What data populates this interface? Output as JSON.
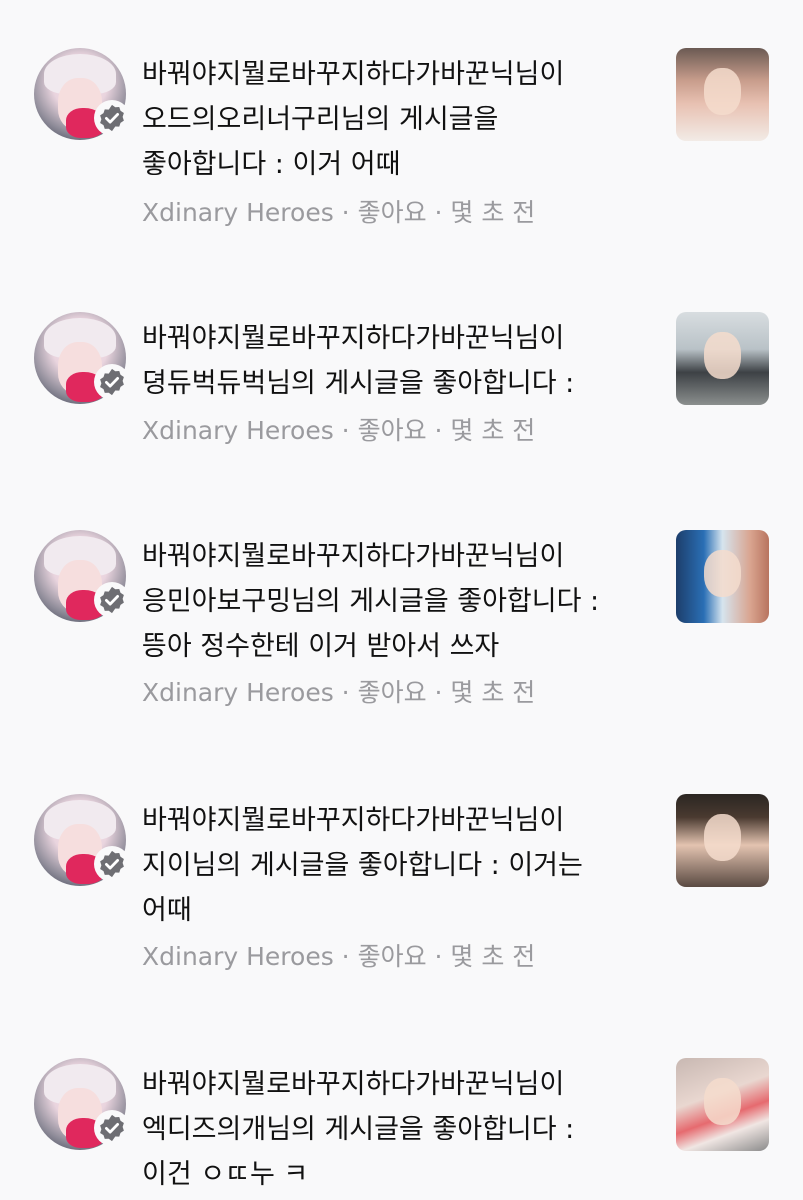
{
  "notifications": [
    {
      "lines": [
        "바꿔야지뭘로바꾸지하다가바꾼닉님이",
        "오드의오리너구리님의 게시글을",
        "좋아합니다 : 이거 어때"
      ],
      "meta": "Xdinary Heroes · 좋아요 · 몇 초 전"
    },
    {
      "lines": [
        "바꿔야지뭘로바꾸지하다가바꾼닉님이",
        "뎡듀벅듀벅님의 게시글을 좋아합니다 :"
      ],
      "meta": "Xdinary Heroes · 좋아요 · 몇 초 전"
    },
    {
      "lines": [
        "바꿔야지뭘로바꾸지하다가바꾼닉님이",
        "응민아보구밍님의 게시글을 좋아합니다 :",
        "뜽아 정수한테 이거 받아서 쓰자"
      ],
      "meta": "Xdinary Heroes · 좋아요 · 몇 초 전"
    },
    {
      "lines": [
        "바꿔야지뭘로바꾸지하다가바꾼닉님이",
        "지이님의 게시글을 좋아합니다 : 이거는",
        "어때"
      ],
      "meta": "Xdinary Heroes · 좋아요 · 몇 초 전"
    },
    {
      "lines": [
        "바꿔야지뭘로바꾸지하다가바꾼닉님이",
        "엑디즈의개님의 게시글을 좋아합니다 :",
        "이건 ㅇㄸ누 ㅋ"
      ],
      "meta": ""
    }
  ],
  "icons": {
    "avatar": "profile-avatar-icon",
    "badge": "verified-badge-icon"
  },
  "colors": {
    "background": "#f9f9fa",
    "text": "#111111",
    "meta": "#9a9a9e",
    "badge": "#6e6e73"
  }
}
